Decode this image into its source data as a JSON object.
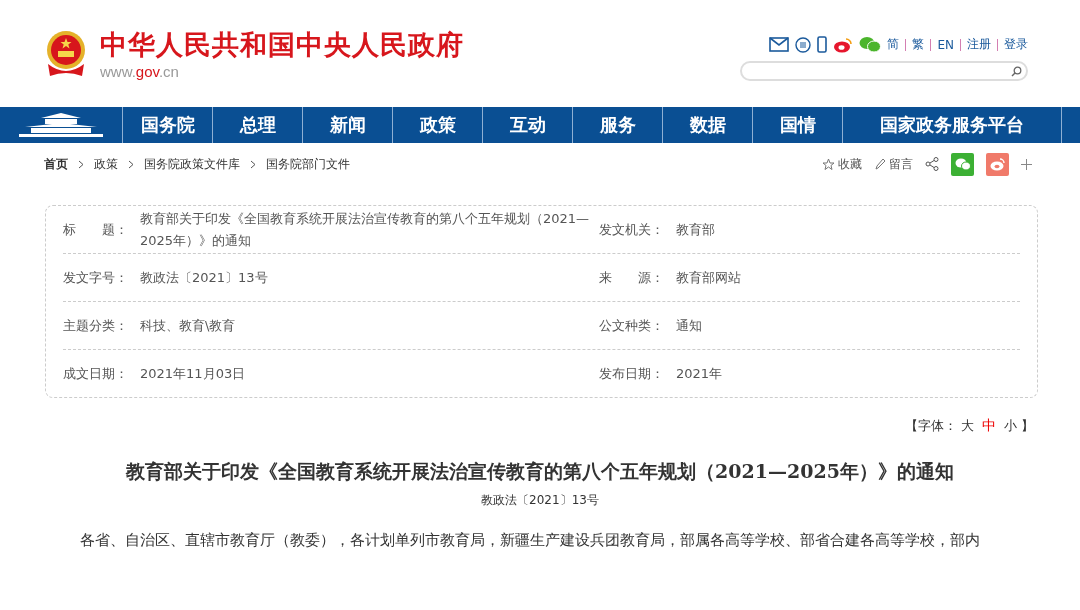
{
  "header": {
    "site_title": "中华人民共和国中央人民政府",
    "site_url_prefix": "www.",
    "site_url_domain": "gov",
    "site_url_suffix": ".cn",
    "links": [
      "简",
      "繁",
      "EN",
      "注册",
      "登录"
    ]
  },
  "nav": {
    "items": [
      "国务院",
      "总理",
      "新闻",
      "政策",
      "互动",
      "服务",
      "数据",
      "国情",
      "国家政务服务平台"
    ]
  },
  "breadcrumb": [
    "首页",
    "政策",
    "国务院政策文件库",
    "国务院部门文件"
  ],
  "actions": [
    {
      "kind": "star",
      "label": "收藏"
    },
    {
      "kind": "pen",
      "label": "留言"
    }
  ],
  "info": {
    "rows": [
      {
        "left": {
          "label": "标　　题：",
          "value": "教育部关于印发《全国教育系统开展法治宣传教育的第八个五年规划（2021—2025年）》的通知"
        },
        "right": {
          "label": "发文机关：",
          "value": "教育部"
        }
      },
      {
        "left": {
          "label": "发文字号：",
          "value": "教政法〔2021〕13号"
        },
        "right": {
          "label": "来　　源：",
          "value": "教育部网站"
        }
      },
      {
        "left": {
          "label": "主题分类：",
          "value": "科技、教育\\教育"
        },
        "right": {
          "label": "公文种类：",
          "value": "通知"
        }
      },
      {
        "left": {
          "label": "成文日期：",
          "value": "2021年11月03日"
        },
        "right": {
          "label": "发布日期：",
          "value": "2021年"
        }
      }
    ]
  },
  "font_size": {
    "open": "【",
    "label": "字体：",
    "options": [
      {
        "label": "大",
        "selected": false
      },
      {
        "label": "中",
        "selected": true
      },
      {
        "label": "小",
        "selected": false
      }
    ],
    "close": "】"
  },
  "article": {
    "title": "教育部关于印发《全国教育系统开展法治宣传教育的第八个五年规划（2021—2025年）》的通知",
    "doc_number": "教政法〔2021〕13号",
    "body": "各省、自治区、直辖市教育厅（教委），各计划单列市教育局，新疆生产建设兵团教育局，部属各高等学校、部省合建各高等学校，部内"
  }
}
